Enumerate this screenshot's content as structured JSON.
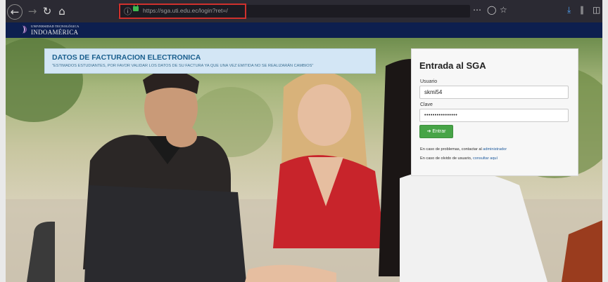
{
  "browser": {
    "url": "https://sga.uti.edu.ec/login?ret=/",
    "icons": [
      "back-icon",
      "forward-icon",
      "reload-icon",
      "home-icon",
      "info-icon",
      "lock-icon",
      "more-icon",
      "pocket-icon",
      "bookmark-star-icon",
      "download-icon",
      "library-icon",
      "sidebar-icon"
    ]
  },
  "site": {
    "logo_line1": "UNIVERSIDAD TECNOLÓGICA",
    "logo_line2": "INDOAMÉRICA"
  },
  "notice": {
    "title": "DATOS DE FACTURACION ELECTRONICA",
    "text": "\"ESTIMADOS ESTUDIANTES, POR FAVOR VALIDAR LOS DATOS DE SU FACTURA YA QUE UNA VEZ EMITIDA NO SE REALIZARÁN CAMBIOS\""
  },
  "login": {
    "title": "Entrada al SGA",
    "user_label": "Usuario",
    "user_value": "skmi54",
    "pass_label": "Clave",
    "pass_value": "••••••••••••••••",
    "submit_label": "➔ Entrar",
    "help1_prefix": "En caso de problemas, contactar al",
    "help1_link": "administrador",
    "help2_prefix": "En caso de olvido de usuario,",
    "help2_link": "consultar aquí"
  },
  "colors": {
    "toolbar": "#2b2a33",
    "site_header": "#0d1f4f",
    "url_highlight": "#d0312d",
    "notice_bg": "#d3e6f5",
    "notice_title": "#1a5f8e",
    "submit_bg": "#47a447"
  }
}
